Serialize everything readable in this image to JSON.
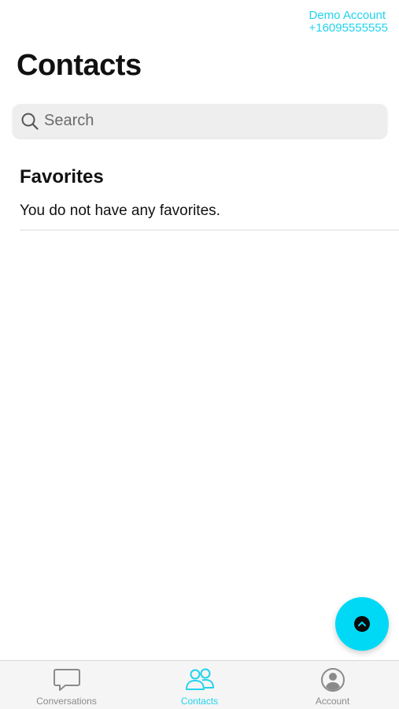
{
  "account": {
    "name": "Demo Account",
    "phone": "+16095555555"
  },
  "page": {
    "title": "Contacts"
  },
  "search": {
    "placeholder": "Search",
    "icon": "search-icon"
  },
  "favorites": {
    "title": "Favorites",
    "empty_message": "You do not have any favorites."
  },
  "fab": {
    "icon": "chevron-up-icon"
  },
  "tabs": [
    {
      "label": "Conversations",
      "icon": "chat-bubble-icon",
      "active": false
    },
    {
      "label": "Contacts",
      "icon": "people-icon",
      "active": true
    },
    {
      "label": "Account",
      "icon": "user-circle-icon",
      "active": false
    }
  ],
  "colors": {
    "accent": "#22d3ee",
    "fab": "#00d9f5",
    "inactive": "#8a8a8a"
  }
}
